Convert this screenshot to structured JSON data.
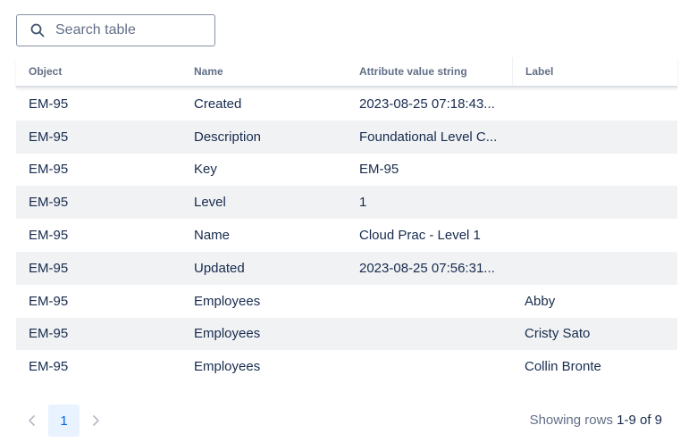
{
  "search": {
    "placeholder": "Search table",
    "icon": "search-icon"
  },
  "table": {
    "columns": [
      "Object",
      "Name",
      "Attribute value string",
      "Label"
    ],
    "rows": [
      [
        "EM-95",
        "Created",
        "2023-08-25 07:18:43...",
        ""
      ],
      [
        "EM-95",
        "Description",
        "Foundational Level C...",
        ""
      ],
      [
        "EM-95",
        "Key",
        "EM-95",
        ""
      ],
      [
        "EM-95",
        "Level",
        "1",
        ""
      ],
      [
        "EM-95",
        "Name",
        "Cloud Prac - Level 1",
        ""
      ],
      [
        "EM-95",
        "Updated",
        "2023-08-25 07:56:31...",
        ""
      ],
      [
        "EM-95",
        "Employees",
        "",
        "Abby"
      ],
      [
        "EM-95",
        "Employees",
        "",
        "Cristy Sato"
      ],
      [
        "EM-95",
        "Employees",
        "",
        "Collin Bronte"
      ]
    ]
  },
  "pagination": {
    "current_page": "1",
    "prev_icon": "chevron-left-icon",
    "next_icon": "chevron-right-icon",
    "summary_prefix": "Showing rows",
    "summary_range": "1-9 of 9"
  },
  "colors": {
    "row_alt": "#f1f2f4",
    "page_active_bg": "#e9f2ff",
    "page_active_text": "#0c66e4"
  }
}
